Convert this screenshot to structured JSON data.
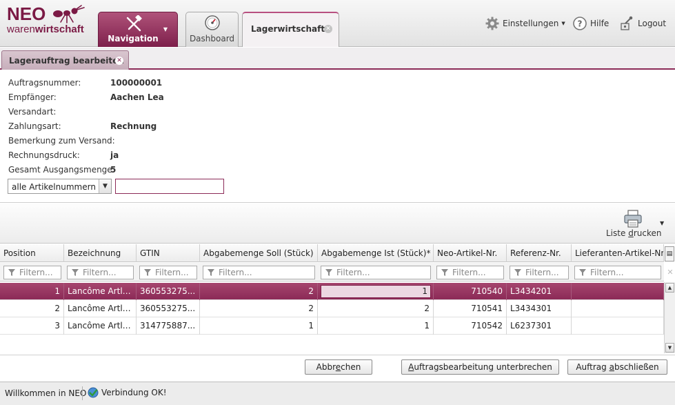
{
  "header": {
    "logo_top": "NEO",
    "logo_bottom_light": "waren",
    "logo_bottom_bold": "wirtschaft",
    "tabs": [
      {
        "label": "Navigation"
      },
      {
        "label": "Dashboard"
      },
      {
        "label": "Lagerwirtschaft"
      }
    ],
    "actions": {
      "settings": "Einstellungen",
      "help": "Hilfe",
      "logout": "Logout"
    }
  },
  "subtab": {
    "label": "Lagerauftrag bearbeiten"
  },
  "info": {
    "auftragsnummer_label": "Auftragsnummer:",
    "auftragsnummer_value": "100000001",
    "empfaenger_label": "Empfänger:",
    "empfaenger_value": "Aachen Lea",
    "versandart_label": "Versandart:",
    "versandart_value": "",
    "zahlungsart_label": "Zahlungsart:",
    "zahlungsart_value": "Rechnung",
    "bemerkung_label": "Bemerkung zum Versand:",
    "bemerkung_value": "",
    "rechnungsdruck_label": "Rechnungsdruck:",
    "rechnungsdruck_value": "ja",
    "gesamt_label": "Gesamt Ausgangsmenge:",
    "gesamt_value": "5"
  },
  "filter": {
    "select_value": "alle Artikelnummern",
    "input_value": ""
  },
  "toolbar": {
    "print_label_pre": "Liste ",
    "print_label_u": "d",
    "print_label_post": "rucken"
  },
  "grid": {
    "columns": [
      "Position",
      "Bezeichnung",
      "GTIN",
      "Abgabemenge Soll (Stück)",
      "Abgabemenge Ist (Stück)*",
      "Neo-Artikel-Nr.",
      "Referenz-Nr.",
      "Lieferanten-Artikel-Nr."
    ],
    "filter_placeholder": "Filtern...",
    "rows": [
      [
        "1",
        "Lancôme Artlin...",
        "360553275...",
        "2",
        "1",
        "710540",
        "L3434201",
        ""
      ],
      [
        "2",
        "Lancôme Artlin...",
        "360553275...",
        "2",
        "2",
        "710541",
        "L3434301",
        ""
      ],
      [
        "3",
        "Lancôme Artlin...",
        "314775887...",
        "1",
        "1",
        "710542",
        "L6237301",
        ""
      ]
    ],
    "selected_row": 0
  },
  "buttons": {
    "cancel_pre": "Abbr",
    "cancel_u": "e",
    "cancel_post": "chen",
    "interrupt_pre": "",
    "interrupt_u": "A",
    "interrupt_post": "uftragsbearbeitung unterbrechen",
    "finish_pre": "Auftrag ",
    "finish_u": "a",
    "finish_post": "bschließen"
  },
  "status": {
    "welcome": "Willkommen in NEO",
    "connection": "Verbindung OK!"
  },
  "colors": {
    "accent": "#8b2a57",
    "selected_row": "#9a3864",
    "status_ok": "#2e9a3a"
  }
}
